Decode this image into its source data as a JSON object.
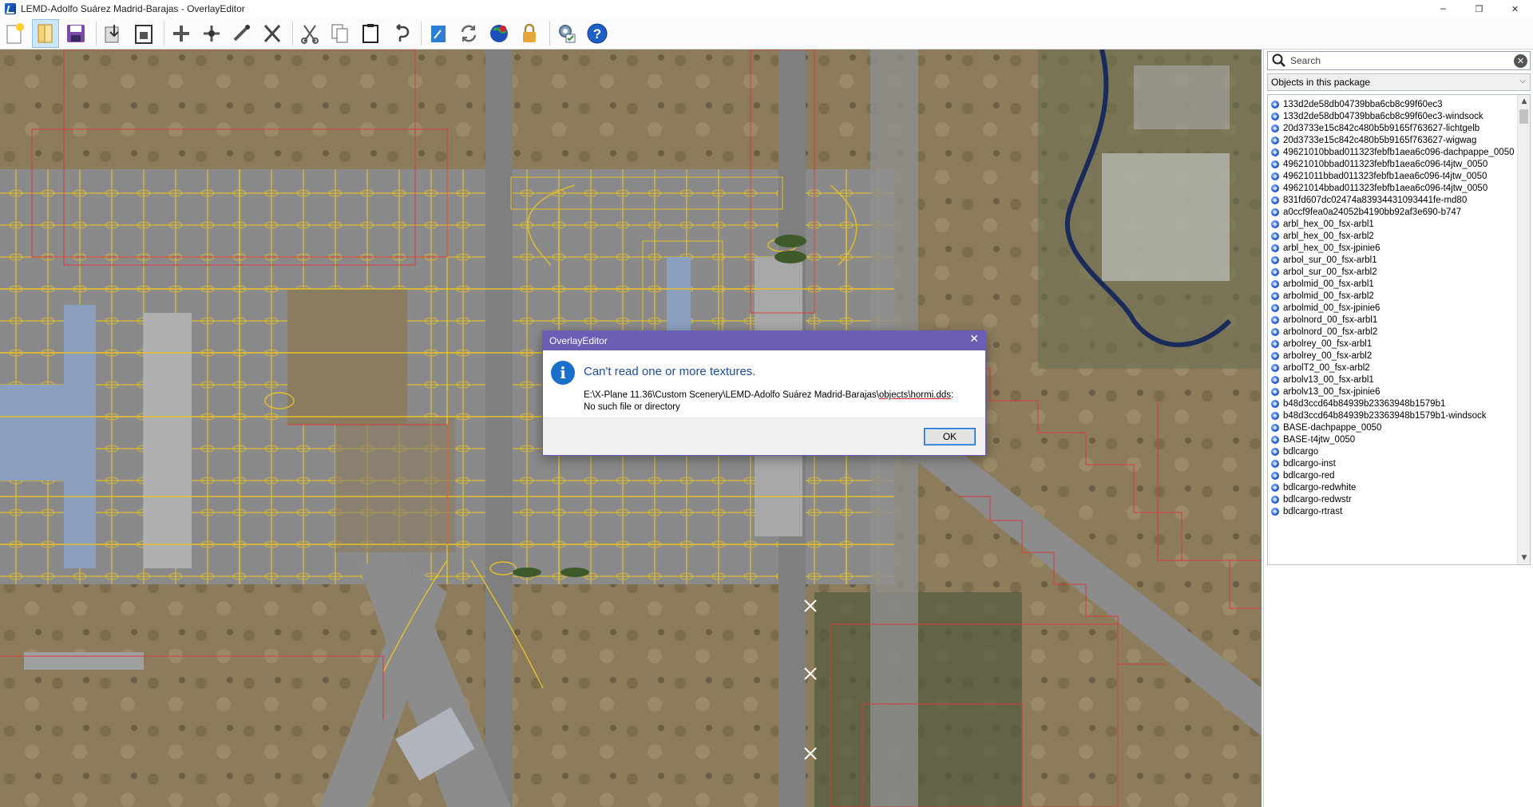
{
  "window": {
    "title": "LEMD-Adolfo Suárez Madrid-Barajas - OverlayEditor",
    "minimize": "─",
    "restore": "❐",
    "close": "✕"
  },
  "toolbar": {
    "buttons": [
      "new-icon",
      "open-icon",
      "save-icon",
      "import-icon",
      "export-icon",
      "add-node-icon",
      "add-point-icon",
      "edit-icon",
      "delete-icon",
      "cut-icon",
      "copy-icon",
      "paste-icon",
      "undo-icon",
      "bring-front-icon",
      "refresh-icon",
      "globe-icon",
      "lock-icon",
      "preferences-icon",
      "help-icon"
    ]
  },
  "search": {
    "placeholder": "Search",
    "clear": "✕"
  },
  "filter": {
    "selected": "Objects in this package",
    "arrow": "⌵"
  },
  "objects": [
    "133d2de58db04739bba6cb8c99f60ec3",
    "133d2de58db04739bba6cb8c99f60ec3-windsock",
    "20d3733e15c842c480b5b9165f763627-lichtgelb",
    "20d3733e15c842c480b5b9165f763627-wigwag",
    "49621010bbad011323febfb1aea6c096-dachpappe_0050",
    "49621010bbad011323febfb1aea6c096-t4jtw_0050",
    "49621011bbad011323febfb1aea6c096-t4jtw_0050",
    "49621014bbad011323febfb1aea6c096-t4jtw_0050",
    "831fd607dc02474a83934431093441fe-md80",
    "a0ccf9fea0a24052b4190bb92af3e690-b747",
    "arbl_hex_00_fsx-arbl1",
    "arbl_hex_00_fsx-arbl2",
    "arbl_hex_00_fsx-jpinie6",
    "arbol_sur_00_fsx-arbl1",
    "arbol_sur_00_fsx-arbl2",
    "arbolmid_00_fsx-arbl1",
    "arbolmid_00_fsx-arbl2",
    "arbolmid_00_fsx-jpinie6",
    "arbolnord_00_fsx-arbl1",
    "arbolnord_00_fsx-arbl2",
    "arbolrey_00_fsx-arbl1",
    "arbolrey_00_fsx-arbl2",
    "arbolT2_00_fsx-arbl2",
    "arbolv13_00_fsx-arbl1",
    "arbolv13_00_fsx-jpinie6",
    "b48d3ccd64b84939b23363948b1579b1",
    "b48d3ccd64b84939b23363948b1579b1-windsock",
    "BASE-dachpappe_0050",
    "BASE-t4jtw_0050",
    "bdlcargo",
    "bdlcargo-inst",
    "bdlcargo-red",
    "bdlcargo-redwhite",
    "bdlcargo-redwstr",
    "bdlcargo-rtrast"
  ],
  "scroll": {
    "up": "▲",
    "down": "▼"
  },
  "dialog": {
    "title": "OverlayEditor",
    "close": "✕",
    "icon": "i",
    "heading": "Can't read one or more textures.",
    "path_prefix": "E:\\X-Plane 11.36\\Custom Scenery\\LEMD-Adolfo Suárez Madrid-Barajas\\",
    "path_underlined": "objects\\hormi.dds",
    "path_suffix": ":",
    "detail_line2": "No such file or directory",
    "ok_label": "OK"
  },
  "colors": {
    "dialog_title_bar": "#6b5fb5",
    "heading_blue": "#1e4da0",
    "taxiway_lines": "#e6c02a",
    "boundary_lines": "#d93a3a",
    "pavement": "#8a8a8a"
  }
}
